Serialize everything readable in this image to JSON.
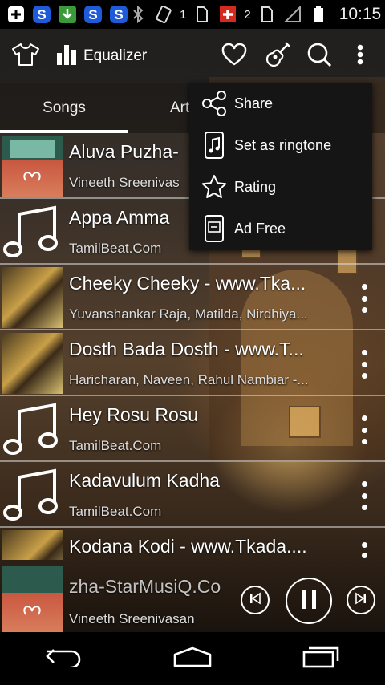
{
  "status_bar": {
    "sim1_label": "1",
    "sim2_label": "2",
    "time": "10:15"
  },
  "action_bar": {
    "equalizer_label": "Equalizer"
  },
  "tabs": [
    {
      "label": "Songs",
      "active": true
    },
    {
      "label": "Art",
      "active": false
    }
  ],
  "songs": [
    {
      "title": "Aluva Puzha-",
      "subtitle": "Vineeth Sreenivas",
      "art": "album-red"
    },
    {
      "title": "Appa Amma",
      "subtitle": "TamilBeat.Com",
      "art": "music-note"
    },
    {
      "title": "Cheeky Cheeky - www.Tka...",
      "subtitle": "Yuvanshankar Raja, Matilda, Nirdhiya...",
      "art": "album-yellow"
    },
    {
      "title": "Dosth Bada Dosth - www.T...",
      "subtitle": "Haricharan, Naveen, Rahul Nambiar -...",
      "art": "album-yellow"
    },
    {
      "title": "Hey Rosu Rosu",
      "subtitle": "TamilBeat.Com",
      "art": "music-note"
    },
    {
      "title": "Kadavulum Kadha",
      "subtitle": "TamilBeat.Com",
      "art": "music-note"
    },
    {
      "title": "Kodana Kodi - www.Tkada....",
      "subtitle": "",
      "art": "album-yellow"
    }
  ],
  "now_playing": {
    "title": "zha-StarMusiQ.Co",
    "artist": "Vineeth Sreenivasan"
  },
  "overflow_menu": [
    {
      "label": "Share",
      "icon": "share-icon"
    },
    {
      "label": "Set as ringtone",
      "icon": "ringtone-phone-icon"
    },
    {
      "label": "Rating",
      "icon": "star-icon"
    },
    {
      "label": "Ad Free",
      "icon": "ad-free-icon"
    }
  ],
  "colors": {
    "popup_bg": "#151515",
    "accent": "#ffffff"
  }
}
